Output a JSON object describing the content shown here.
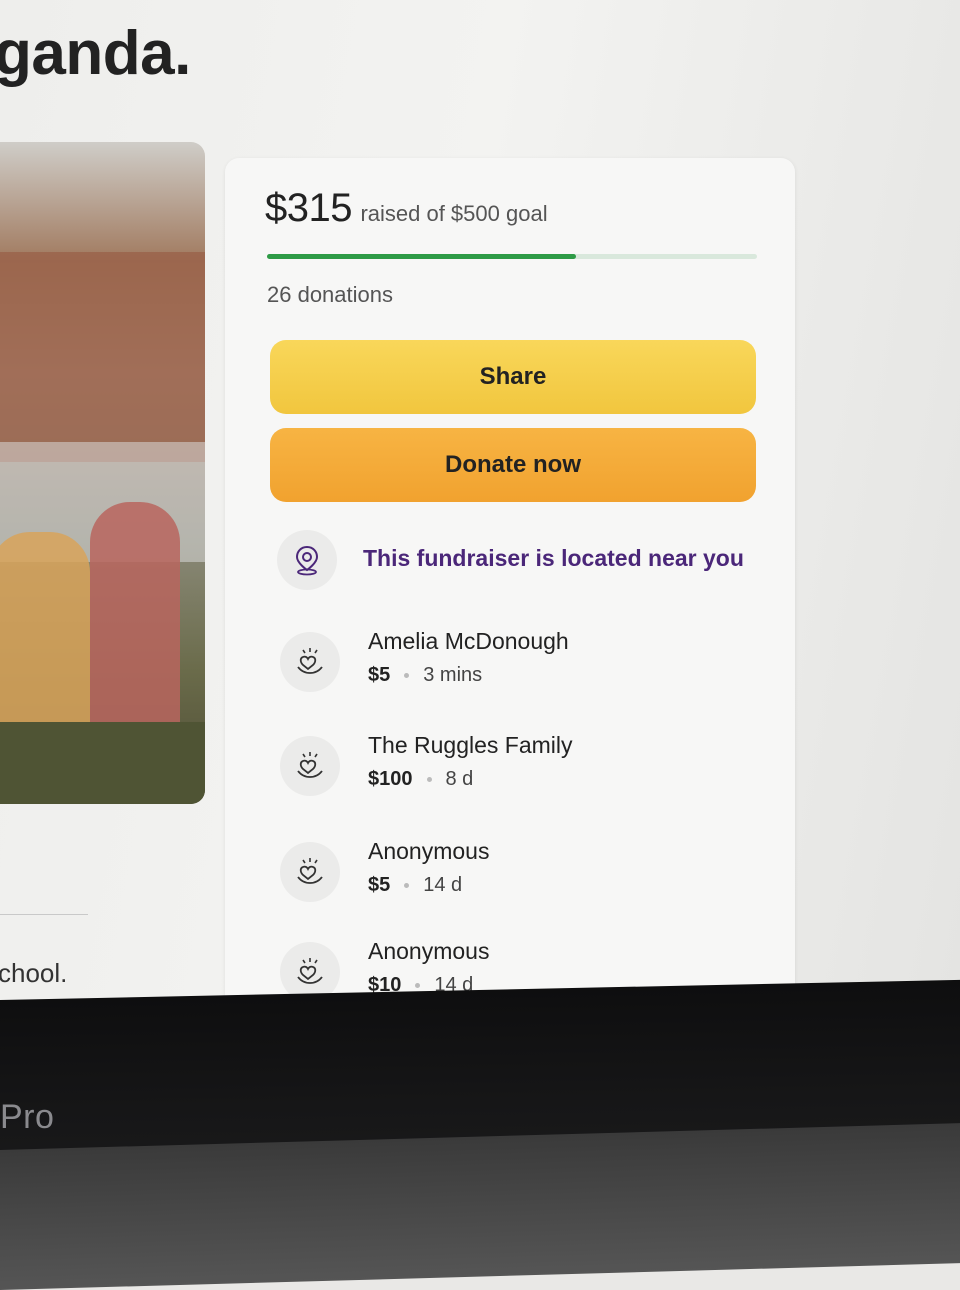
{
  "page": {
    "title_fragment": "ganda.",
    "left_text_fragment": "chool."
  },
  "summary": {
    "amount": "$315",
    "goal_text": "raised of $500 goal",
    "progress_fraction": 0.63,
    "donation_count": "26 donations"
  },
  "buttons": {
    "share_label": "Share",
    "donate_label": "Donate now"
  },
  "location": {
    "text": "This fundraiser is located near you",
    "icon": "map-pin-icon"
  },
  "donations": [
    {
      "name": "Amelia McDonough",
      "amount": "$5",
      "time": "3 mins",
      "icon": "donation-heart-icon"
    },
    {
      "name": "The Ruggles Family",
      "amount": "$100",
      "time": "8 d",
      "icon": "donation-heart-icon"
    },
    {
      "name": "Anonymous",
      "amount": "$5",
      "time": "14 d",
      "icon": "donation-heart-icon"
    },
    {
      "name": "Anonymous",
      "amount": "$10",
      "time": "14 d",
      "icon": "donation-heart-icon"
    }
  ],
  "device": {
    "label": "Pro"
  },
  "colors": {
    "progress": "#2e9b46",
    "share_button": "#f4cc49",
    "donate_button": "#f3aa36",
    "location_text": "#4b2779"
  }
}
